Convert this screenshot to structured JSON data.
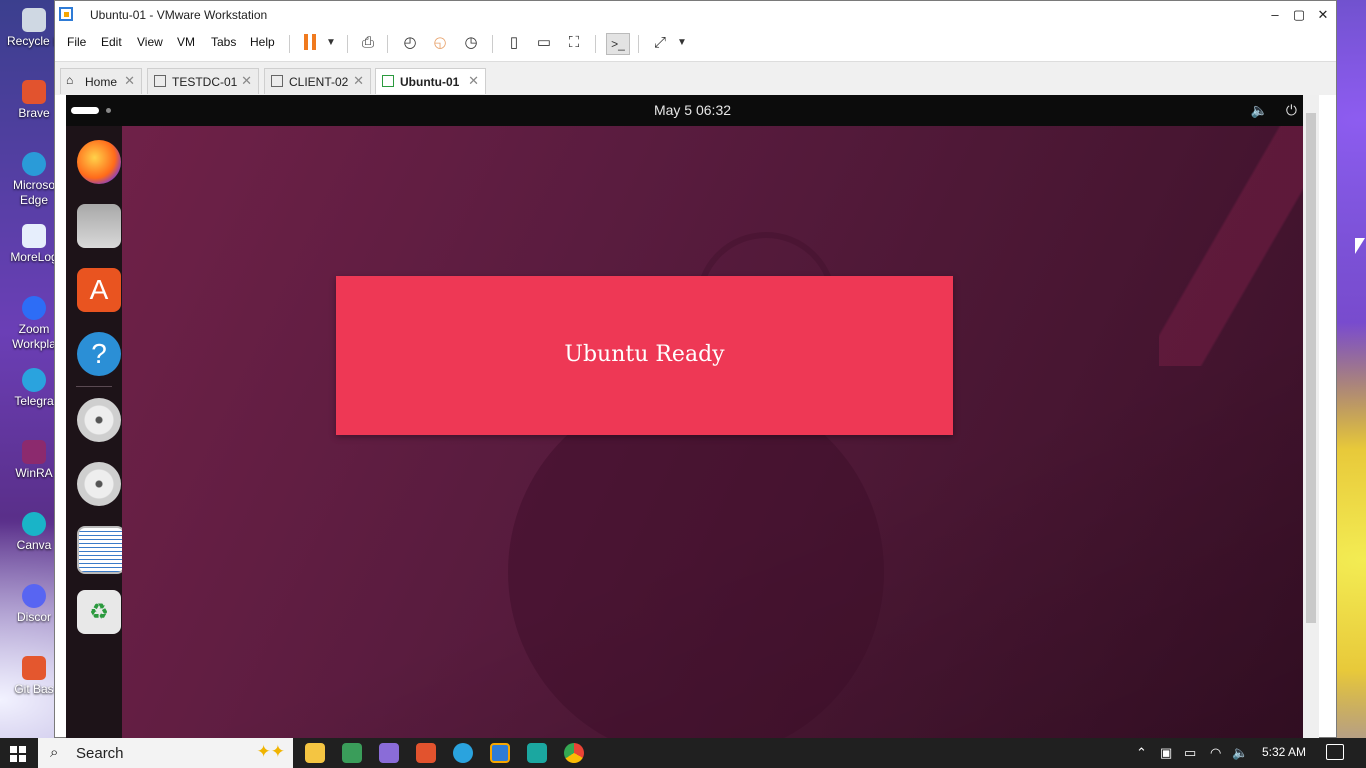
{
  "desktop": {
    "icons": [
      {
        "name": "recycle-bin-icon",
        "label": "Recycle B"
      },
      {
        "name": "brave-icon",
        "label": "Brave"
      },
      {
        "name": "edge-icon",
        "label": "Microso\nEdge"
      },
      {
        "name": "morelogin-icon",
        "label": "MoreLog"
      },
      {
        "name": "zoom-icon",
        "label": "Zoom\nWorkpla"
      },
      {
        "name": "telegram-icon",
        "label": "Telegra"
      },
      {
        "name": "winrar-icon",
        "label": "WinRA"
      },
      {
        "name": "canva-icon",
        "label": "Canva"
      },
      {
        "name": "discord-icon",
        "label": "Discor"
      },
      {
        "name": "gitbash-icon",
        "label": "Git Bas"
      }
    ]
  },
  "window": {
    "title": "Ubuntu-01 - VMware Workstation",
    "minimize": "–",
    "maximize": "▢",
    "close": "✕"
  },
  "menu": {
    "file": "File",
    "edit": "Edit",
    "view": "View",
    "vm": "VM",
    "tabs": "Tabs",
    "help": "Help"
  },
  "tabs": [
    {
      "label": "Home",
      "active": false
    },
    {
      "label": "TESTDC-01",
      "active": false
    },
    {
      "label": "CLIENT-02",
      "active": false
    },
    {
      "label": "Ubuntu-01",
      "active": true
    }
  ],
  "ubuntu": {
    "clock": "May 5  06:32",
    "banner": "Ubuntu Ready"
  },
  "taskbar": {
    "search_placeholder": "Search",
    "time": "5:32 AM"
  },
  "colors": {
    "banner": "#ee3855",
    "pause": "#f07a1e",
    "wallpaper": "#5a1c3f"
  }
}
